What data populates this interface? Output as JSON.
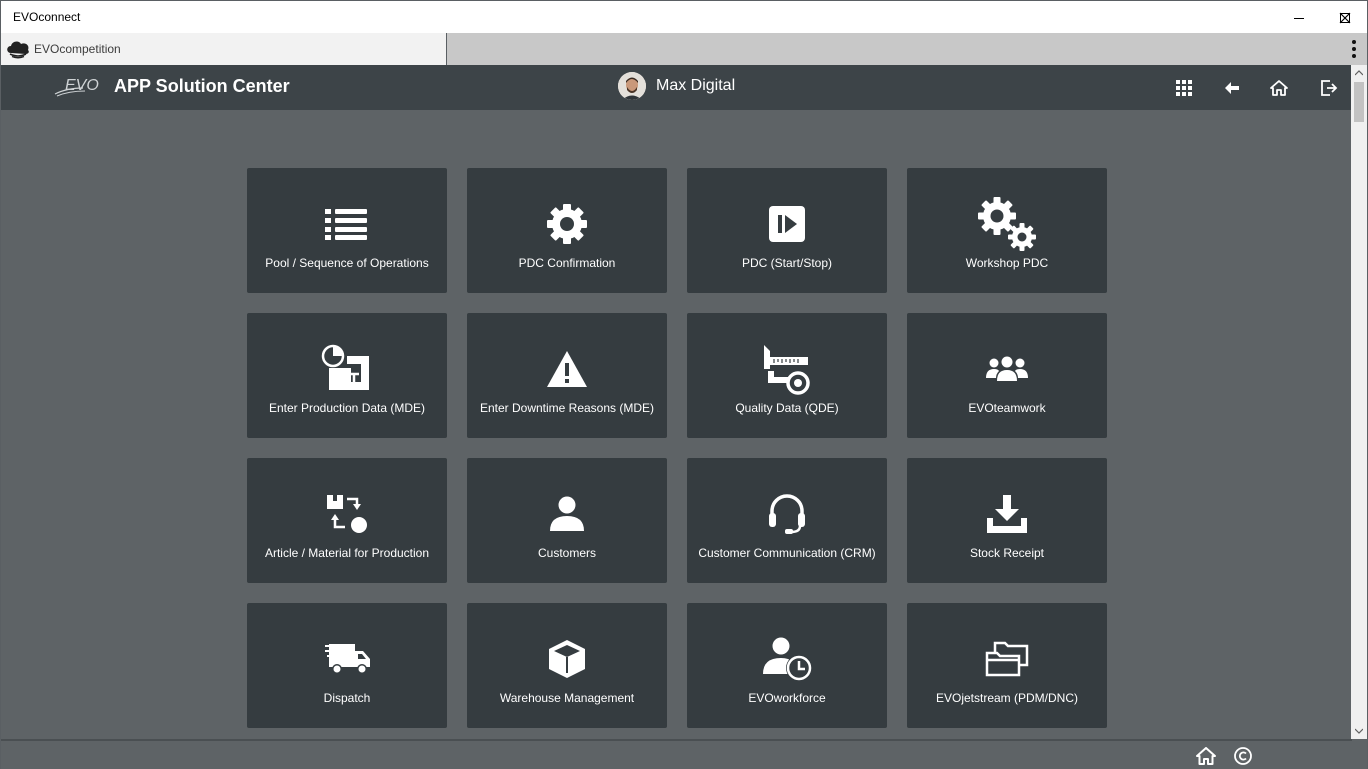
{
  "window": {
    "title": "EVOconnect",
    "controls": [
      "minimize-icon",
      "maximize-icon",
      "close-icon"
    ]
  },
  "tabbar": {
    "active_tab": {
      "label": "EVOcompetition",
      "icon": "cloud-icon"
    },
    "menu_icon": "kebab-menu-icon"
  },
  "header": {
    "logo_text": "EVO",
    "title": "APP Solution Center",
    "user_name": "Max Digital",
    "actions": [
      "apps-grid-icon",
      "back-arrow-icon",
      "home-icon",
      "logout-icon"
    ]
  },
  "tiles": [
    {
      "label": "Pool / Sequence of Operations",
      "icon": "list-icon"
    },
    {
      "label": "PDC Confirmation",
      "icon": "gear-icon"
    },
    {
      "label": "PDC (Start/Stop)",
      "icon": "play-pause-icon"
    },
    {
      "label": "Workshop PDC",
      "icon": "gears-icon"
    },
    {
      "label": "Enter Production Data (MDE)",
      "icon": "machine-data-icon"
    },
    {
      "label": "Enter Downtime Reasons (MDE)",
      "icon": "warning-icon"
    },
    {
      "label": "Quality Data (QDE)",
      "icon": "caliper-icon"
    },
    {
      "label": "EVOteamwork",
      "icon": "team-icon"
    },
    {
      "label": "Article / Material for Production",
      "icon": "material-flow-icon"
    },
    {
      "label": "Customers",
      "icon": "user-icon"
    },
    {
      "label": "Customer Communication (CRM)",
      "icon": "headset-icon"
    },
    {
      "label": "Stock Receipt",
      "icon": "download-icon"
    },
    {
      "label": "Dispatch",
      "icon": "truck-icon"
    },
    {
      "label": "Warehouse Management",
      "icon": "box-icon"
    },
    {
      "label": "EVOworkforce",
      "icon": "user-clock-icon"
    },
    {
      "label": "EVOjetstream (PDM/DNC)",
      "icon": "folders-icon"
    }
  ],
  "footer": {
    "icons": [
      "home-icon",
      "copyright-icon"
    ]
  },
  "colors": {
    "header_bg": "#3d4448",
    "content_bg": "#5e6366",
    "tile_bg": "#353c40",
    "text": "#ffffff"
  }
}
